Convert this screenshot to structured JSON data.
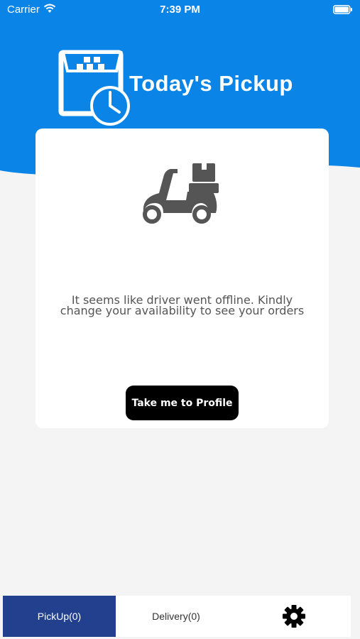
{
  "status_bar": {
    "carrier": "Carrier",
    "time": "7:39 PM"
  },
  "header": {
    "title": "Today's Pickup",
    "background_color": "#0a84e6"
  },
  "empty_state": {
    "message": "It seems like driver went offline. Kindly change your availability to see your orders",
    "icon": "scooter-icon",
    "button_label": "Take me to Profile"
  },
  "tabbar": {
    "tabs": [
      {
        "label": "PickUp(0)",
        "active": true
      },
      {
        "label": "Delivery(0)",
        "active": false
      }
    ],
    "settings_icon": "gear-icon",
    "active_color": "#23408f"
  }
}
